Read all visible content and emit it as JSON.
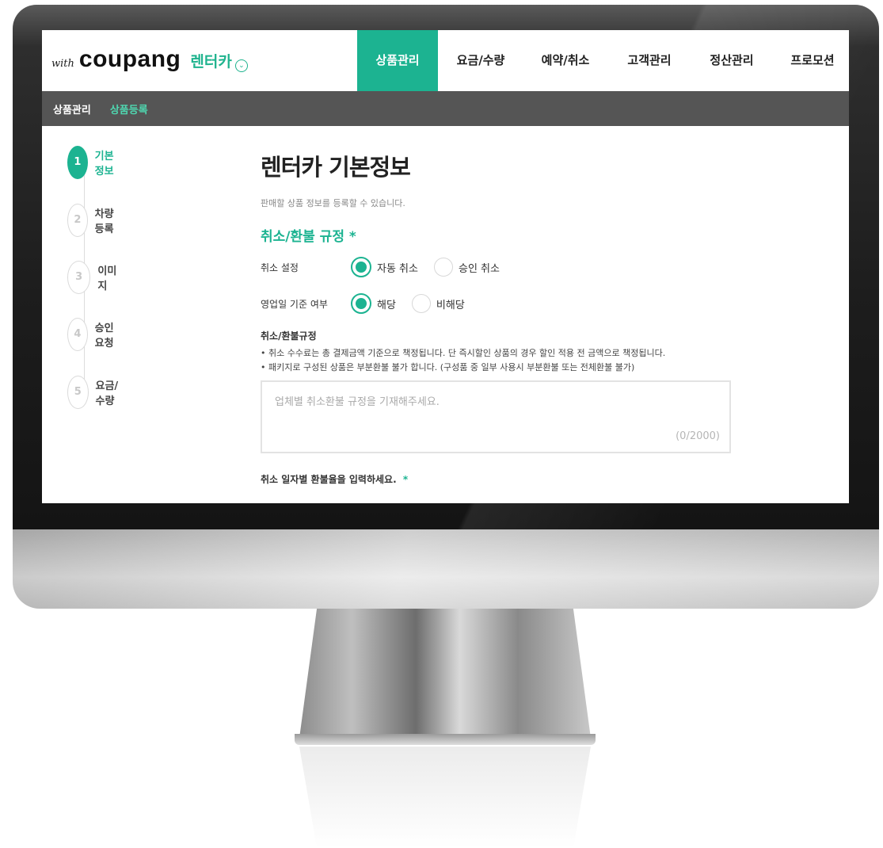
{
  "brand": {
    "with": "with",
    "name": "coupang",
    "service": "렌터카",
    "chevron": "⌄"
  },
  "nav": [
    {
      "label": "상품관리",
      "active": true
    },
    {
      "label": "요금/수량",
      "active": false
    },
    {
      "label": "예약/취소",
      "active": false
    },
    {
      "label": "고객관리",
      "active": false
    },
    {
      "label": "정산관리",
      "active": false
    },
    {
      "label": "프로모션",
      "active": false
    }
  ],
  "subnav": {
    "section": "상품관리",
    "current": "상품등록"
  },
  "steps": [
    {
      "num": "1",
      "label": "기본정보",
      "active": true
    },
    {
      "num": "2",
      "label": "차량등록",
      "active": false
    },
    {
      "num": "3",
      "label": "이미지",
      "active": false
    },
    {
      "num": "4",
      "label": "승인요청",
      "active": false
    },
    {
      "num": "5",
      "label": "요금/수량",
      "active": false
    }
  ],
  "page": {
    "title": "렌터카 기본정보",
    "description": "판매할 상품 정보를 등록할 수 있습니다.",
    "section_title": "취소/환불 규정",
    "required_mark": "*"
  },
  "cancel_setting": {
    "label": "취소 설정",
    "options": [
      "자동 취소",
      "승인 취소"
    ],
    "selected": "자동 취소"
  },
  "business_day": {
    "label": "영업일 기준 여부",
    "options": [
      "해당",
      "비해당"
    ],
    "selected": "해당"
  },
  "policy": {
    "title": "취소/환불규정",
    "notes": [
      "• 취소 수수료는 총 결제금액 기준으로 책정됩니다. 단 즉시할인 상품의 경우 할인 적용 전 금액으로 책정됩니다.",
      "• 패키지로 구성된 상품은 부분환불 불가 합니다. (구성품 중 일부 사용시 부분환불 또는 전체환불 불가)"
    ],
    "placeholder": "업체별 취소환불 규정을 기재해주세요.",
    "value": "",
    "char_count": "(0/2000)"
  },
  "refund_rate": {
    "label": "취소 일자별 환불율을 입력하세요.",
    "required_mark": "*"
  },
  "colors": {
    "accent": "#1cb391",
    "subbar": "#555555",
    "text": "#222222"
  }
}
